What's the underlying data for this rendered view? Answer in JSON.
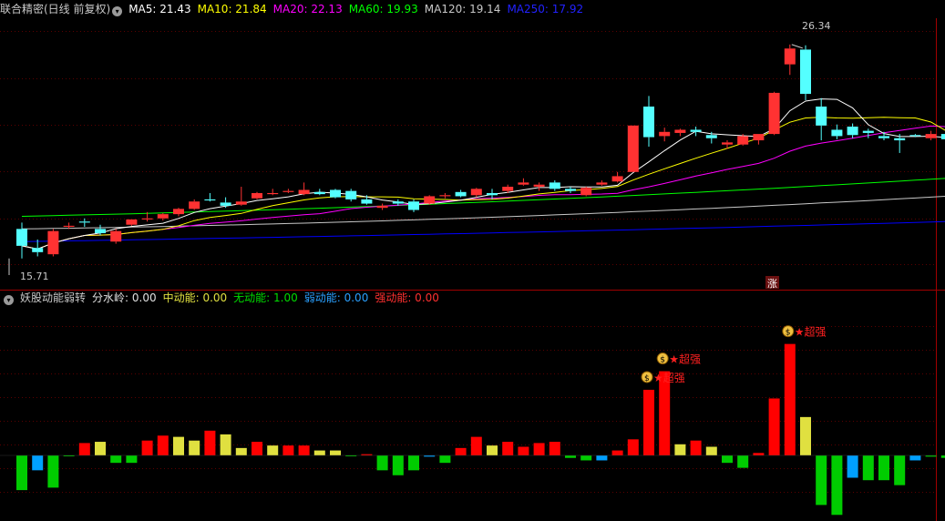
{
  "main_header": {
    "title": "联合精密(日线 前复权)",
    "ma5": "MA5: 21.43",
    "ma10": "MA10: 21.84",
    "ma20": "MA20: 22.13",
    "ma60": "MA60: 19.93",
    "ma120": "MA120: 19.14",
    "ma250": "MA250: 17.92"
  },
  "indicator_header": {
    "title": "妖股动能弱转",
    "fsl": "分水岭: 0.00",
    "zdn": "中动能: 0.00",
    "wdn": "无动能: 1.00",
    "rdn": "弱动能: 0.00",
    "qdn": "强动能: 0.00"
  },
  "annotations": {
    "high": "26.34",
    "low": "15.71",
    "zhang": "涨",
    "super": "超强"
  },
  "colors": {
    "up": "#ff3232",
    "down": "#54ffff",
    "bg": "#000000",
    "ma5": "#ffffff",
    "ma10": "#ffff00",
    "ma20": "#ff00ff",
    "ma60": "#00ff00",
    "ma120": "#c8c8c8",
    "ma250": "#0000ff",
    "ind_red": "#ff0000",
    "ind_yellow": "#e0e040",
    "ind_green": "#00cc00",
    "ind_blue": "#00a0ff"
  },
  "chart_data": [
    {
      "type": "candlestick",
      "ylim": [
        15.5,
        27.5
      ],
      "candles": [
        {
          "o": 17.6,
          "h": 17.9,
          "l": 16.2,
          "c": 16.8
        },
        {
          "o": 16.7,
          "h": 17.1,
          "l": 16.3,
          "c": 16.5
        },
        {
          "o": 16.4,
          "h": 17.6,
          "l": 16.3,
          "c": 17.5
        },
        {
          "o": 17.7,
          "h": 17.9,
          "l": 17.6,
          "c": 17.75
        },
        {
          "o": 17.95,
          "h": 18.1,
          "l": 17.7,
          "c": 17.9
        },
        {
          "o": 17.6,
          "h": 17.8,
          "l": 17.3,
          "c": 17.4
        },
        {
          "o": 17.0,
          "h": 17.6,
          "l": 16.9,
          "c": 17.5
        },
        {
          "o": 17.8,
          "h": 18.05,
          "l": 17.75,
          "c": 18.05
        },
        {
          "o": 18.05,
          "h": 18.4,
          "l": 17.95,
          "c": 18.1
        },
        {
          "o": 18.1,
          "h": 18.35,
          "l": 18.0,
          "c": 18.3
        },
        {
          "o": 18.3,
          "h": 18.6,
          "l": 18.2,
          "c": 18.55
        },
        {
          "o": 18.55,
          "h": 19.0,
          "l": 18.5,
          "c": 18.9
        },
        {
          "o": 19.0,
          "h": 19.3,
          "l": 18.9,
          "c": 18.95
        },
        {
          "o": 18.85,
          "h": 19.1,
          "l": 18.6,
          "c": 18.7
        },
        {
          "o": 18.75,
          "h": 19.6,
          "l": 18.7,
          "c": 18.9
        },
        {
          "o": 19.05,
          "h": 19.35,
          "l": 19.0,
          "c": 19.3
        },
        {
          "o": 19.25,
          "h": 19.5,
          "l": 19.2,
          "c": 19.3
        },
        {
          "o": 19.35,
          "h": 19.5,
          "l": 19.3,
          "c": 19.4
        },
        {
          "o": 19.25,
          "h": 19.8,
          "l": 19.2,
          "c": 19.45
        },
        {
          "o": 19.35,
          "h": 19.5,
          "l": 19.2,
          "c": 19.25
        },
        {
          "o": 19.45,
          "h": 19.5,
          "l": 19.05,
          "c": 19.1
        },
        {
          "o": 19.4,
          "h": 19.5,
          "l": 18.9,
          "c": 19.0
        },
        {
          "o": 19.0,
          "h": 19.2,
          "l": 18.75,
          "c": 18.8
        },
        {
          "o": 18.6,
          "h": 18.8,
          "l": 18.5,
          "c": 18.7
        },
        {
          "o": 18.9,
          "h": 19.0,
          "l": 18.7,
          "c": 18.8
        },
        {
          "o": 18.9,
          "h": 19.0,
          "l": 18.4,
          "c": 18.5
        },
        {
          "o": 18.8,
          "h": 19.2,
          "l": 18.75,
          "c": 19.15
        },
        {
          "o": 19.15,
          "h": 19.3,
          "l": 19.05,
          "c": 19.2
        },
        {
          "o": 19.35,
          "h": 19.45,
          "l": 19.1,
          "c": 19.15
        },
        {
          "o": 19.2,
          "h": 19.55,
          "l": 19.1,
          "c": 19.5
        },
        {
          "o": 19.3,
          "h": 19.5,
          "l": 19.0,
          "c": 19.2
        },
        {
          "o": 19.4,
          "h": 19.7,
          "l": 19.3,
          "c": 19.6
        },
        {
          "o": 19.7,
          "h": 20.0,
          "l": 19.65,
          "c": 19.8
        },
        {
          "o": 19.6,
          "h": 19.8,
          "l": 19.4,
          "c": 19.7
        },
        {
          "o": 19.8,
          "h": 19.9,
          "l": 19.4,
          "c": 19.5
        },
        {
          "o": 19.5,
          "h": 19.6,
          "l": 19.3,
          "c": 19.4
        },
        {
          "o": 19.2,
          "h": 19.6,
          "l": 19.15,
          "c": 19.55
        },
        {
          "o": 19.7,
          "h": 19.9,
          "l": 19.65,
          "c": 19.8
        },
        {
          "o": 19.85,
          "h": 20.3,
          "l": 19.8,
          "c": 20.1
        },
        {
          "o": 20.3,
          "h": 22.5,
          "l": 20.3,
          "c": 22.5
        },
        {
          "o": 23.4,
          "h": 23.9,
          "l": 21.5,
          "c": 21.95
        },
        {
          "o": 22.0,
          "h": 22.4,
          "l": 21.75,
          "c": 22.2
        },
        {
          "o": 22.15,
          "h": 22.35,
          "l": 22.0,
          "c": 22.3
        },
        {
          "o": 22.3,
          "h": 22.45,
          "l": 22.0,
          "c": 22.2
        },
        {
          "o": 22.05,
          "h": 22.2,
          "l": 21.65,
          "c": 21.9
        },
        {
          "o": 21.6,
          "h": 21.8,
          "l": 21.4,
          "c": 21.7
        },
        {
          "o": 21.6,
          "h": 22.1,
          "l": 21.55,
          "c": 22.0
        },
        {
          "o": 21.8,
          "h": 22.1,
          "l": 21.6,
          "c": 22.1
        },
        {
          "o": 22.1,
          "h": 24.1,
          "l": 22.05,
          "c": 24.05
        },
        {
          "o": 25.4,
          "h": 26.34,
          "l": 24.9,
          "c": 26.15
        },
        {
          "o": 26.1,
          "h": 26.3,
          "l": 23.7,
          "c": 24.0
        },
        {
          "o": 23.4,
          "h": 23.8,
          "l": 21.8,
          "c": 22.5
        },
        {
          "o": 22.3,
          "h": 22.55,
          "l": 21.85,
          "c": 22.0
        },
        {
          "o": 22.45,
          "h": 22.6,
          "l": 21.9,
          "c": 22.05
        },
        {
          "o": 22.25,
          "h": 22.35,
          "l": 21.9,
          "c": 22.15
        },
        {
          "o": 22.0,
          "h": 22.2,
          "l": 21.8,
          "c": 21.9
        },
        {
          "o": 21.9,
          "h": 22.1,
          "l": 21.2,
          "c": 21.8
        },
        {
          "o": 22.05,
          "h": 22.1,
          "l": 21.95,
          "c": 22.0
        },
        {
          "o": 21.9,
          "h": 22.25,
          "l": 21.8,
          "c": 22.1
        },
        {
          "o": 22.1,
          "h": 22.35,
          "l": 21.6,
          "c": 21.85
        }
      ]
    },
    {
      "type": "bar",
      "ylim": [
        -2.5,
        5.7
      ],
      "values": [
        {
          "v": -1.4,
          "c": "green"
        },
        {
          "v": -0.6,
          "c": "blue"
        },
        {
          "v": -1.3,
          "c": "green"
        },
        {
          "v": 0.0,
          "c": "green"
        },
        {
          "v": 0.5,
          "c": "red"
        },
        {
          "v": 0.55,
          "c": "yellow"
        },
        {
          "v": -0.3,
          "c": "green"
        },
        {
          "v": -0.3,
          "c": "green"
        },
        {
          "v": 0.6,
          "c": "red"
        },
        {
          "v": 0.8,
          "c": "red"
        },
        {
          "v": 0.75,
          "c": "yellow"
        },
        {
          "v": 0.6,
          "c": "yellow"
        },
        {
          "v": 1.0,
          "c": "red"
        },
        {
          "v": 0.85,
          "c": "yellow"
        },
        {
          "v": 0.3,
          "c": "yellow"
        },
        {
          "v": 0.55,
          "c": "red"
        },
        {
          "v": 0.4,
          "c": "yellow"
        },
        {
          "v": 0.4,
          "c": "red"
        },
        {
          "v": 0.4,
          "c": "red"
        },
        {
          "v": 0.2,
          "c": "yellow"
        },
        {
          "v": 0.2,
          "c": "yellow"
        },
        {
          "v": 0.0,
          "c": "green"
        },
        {
          "v": 0.05,
          "c": "red"
        },
        {
          "v": -0.6,
          "c": "green"
        },
        {
          "v": -0.8,
          "c": "green"
        },
        {
          "v": -0.6,
          "c": "green"
        },
        {
          "v": -0.05,
          "c": "blue"
        },
        {
          "v": -0.3,
          "c": "green"
        },
        {
          "v": 0.3,
          "c": "red"
        },
        {
          "v": 0.75,
          "c": "red"
        },
        {
          "v": 0.4,
          "c": "yellow"
        },
        {
          "v": 0.55,
          "c": "red"
        },
        {
          "v": 0.35,
          "c": "red"
        },
        {
          "v": 0.5,
          "c": "red"
        },
        {
          "v": 0.55,
          "c": "red"
        },
        {
          "v": -0.1,
          "c": "green"
        },
        {
          "v": -0.2,
          "c": "green"
        },
        {
          "v": -0.2,
          "c": "blue"
        },
        {
          "v": 0.2,
          "c": "red"
        },
        {
          "v": 0.65,
          "c": "red"
        },
        {
          "v": 2.65,
          "c": "red"
        },
        {
          "v": 3.4,
          "c": "red"
        },
        {
          "v": 0.45,
          "c": "yellow"
        },
        {
          "v": 0.6,
          "c": "red"
        },
        {
          "v": 0.35,
          "c": "yellow"
        },
        {
          "v": -0.3,
          "c": "green"
        },
        {
          "v": -0.5,
          "c": "green"
        },
        {
          "v": 0.1,
          "c": "red"
        },
        {
          "v": 2.3,
          "c": "red"
        },
        {
          "v": 4.5,
          "c": "red"
        },
        {
          "v": 1.55,
          "c": "yellow"
        },
        {
          "v": -2.0,
          "c": "green"
        },
        {
          "v": -2.4,
          "c": "green"
        },
        {
          "v": -0.9,
          "c": "blue"
        },
        {
          "v": -1.0,
          "c": "green"
        },
        {
          "v": -1.0,
          "c": "green"
        },
        {
          "v": -1.2,
          "c": "green"
        },
        {
          "v": -0.2,
          "c": "blue"
        },
        {
          "v": -0.05,
          "c": "green"
        },
        {
          "v": -0.1,
          "c": "green"
        }
      ]
    }
  ]
}
